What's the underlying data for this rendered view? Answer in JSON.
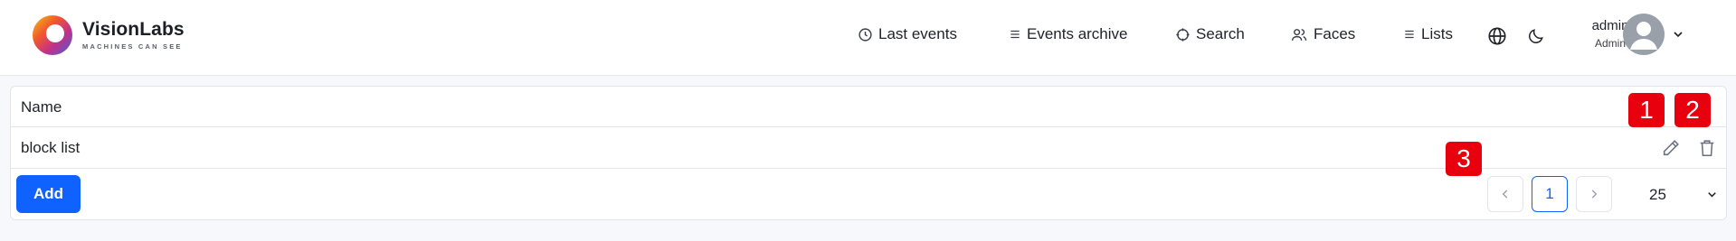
{
  "brand": {
    "name": "VisionLabs",
    "tagline": "MACHINES CAN SEE"
  },
  "nav": {
    "last_events": "Last events",
    "events_archive": "Events archive",
    "search": "Search",
    "faces": "Faces",
    "lists": "Lists"
  },
  "user": {
    "name": "admin",
    "role": "Admin"
  },
  "table": {
    "header_name": "Name",
    "rows": [
      {
        "name": "block list"
      }
    ]
  },
  "footer": {
    "add_label": "Add",
    "current_page": "1",
    "page_size": "25"
  },
  "annotations": {
    "one": "1",
    "two": "2",
    "three": "3"
  },
  "colors": {
    "accent": "#0f62fe",
    "badge": "#e8000e"
  }
}
